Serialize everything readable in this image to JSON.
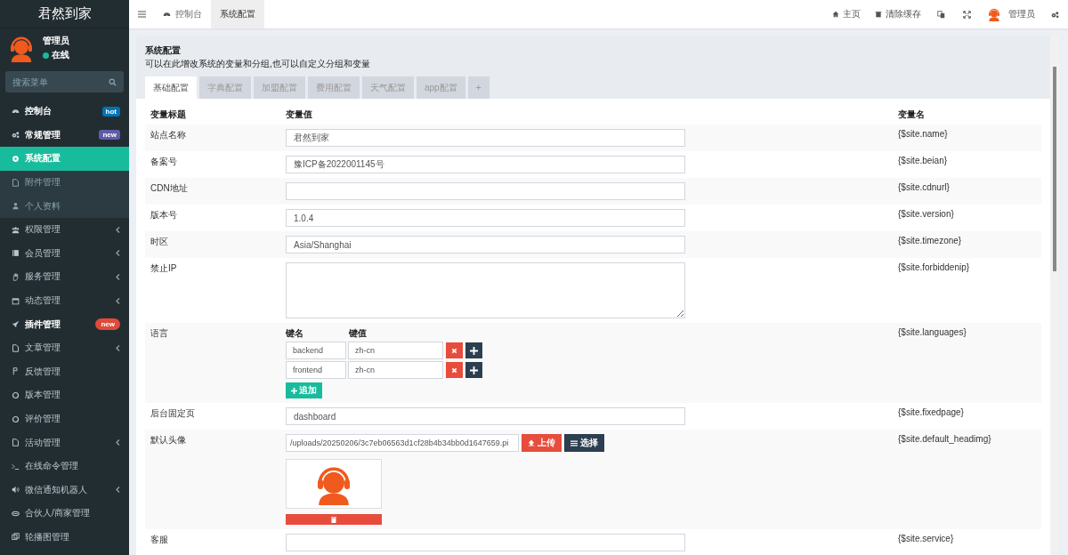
{
  "sidebar": {
    "logo": "君然到家",
    "user": {
      "name": "管理员",
      "status": "在线",
      "online": true
    },
    "search": {
      "placeholder": "搜索菜单"
    },
    "items": [
      {
        "label": "控制台",
        "badge": {
          "text": "hot",
          "color": "#0073b7"
        },
        "caret": false,
        "selected": false
      },
      {
        "label": "常规管理",
        "badge": {
          "text": "new",
          "color": "#605ca8"
        },
        "caret": false,
        "selected": false,
        "expanded": true,
        "children": [
          {
            "label": "系统配置",
            "selected": true
          },
          {
            "label": "附件管理",
            "selected": false
          },
          {
            "label": "个人资料",
            "selected": false
          }
        ]
      },
      {
        "label": "权限管理",
        "caret": true,
        "selected": false
      },
      {
        "label": "会员管理",
        "caret": true,
        "selected": false
      },
      {
        "label": "服务管理",
        "caret": true,
        "selected": false
      },
      {
        "label": "动态管理",
        "caret": true,
        "selected": false
      },
      {
        "label": "插件管理",
        "badge": {
          "text": "new",
          "color": "#dd4b39"
        },
        "caret": false,
        "selected": false
      },
      {
        "label": "文章管理",
        "caret": true,
        "selected": false
      },
      {
        "label": "反馈管理",
        "caret": false,
        "selected": false
      },
      {
        "label": "版本管理",
        "caret": false,
        "selected": false
      },
      {
        "label": "评价管理",
        "caret": false,
        "selected": false
      },
      {
        "label": "活动管理",
        "caret": true,
        "selected": false
      },
      {
        "label": "在线命令管理",
        "caret": false,
        "selected": false
      },
      {
        "label": "微信通知机器人",
        "caret": true,
        "selected": false
      },
      {
        "label": "合伙人/商家管理",
        "caret": false,
        "selected": false
      },
      {
        "label": "轮播图管理",
        "caret": false,
        "selected": false
      }
    ]
  },
  "topbar": {
    "tabs": [
      {
        "label": "控制台",
        "selected": false
      },
      {
        "label": "系统配置",
        "selected": true
      }
    ],
    "links": [
      "主页",
      "清除缓存",
      "管理员"
    ]
  },
  "panel": {
    "title": "系统配置",
    "subtitle": "可以在此增改系统的变量和分组,也可以自定义分组和变量",
    "tabs": [
      {
        "label": "基础配置",
        "selected": true
      },
      {
        "label": "字典配置",
        "selected": false
      },
      {
        "label": "加盟配置",
        "selected": false
      },
      {
        "label": "费用配置",
        "selected": false
      },
      {
        "label": "天气配置",
        "selected": false
      },
      {
        "label": "app配置",
        "selected": false
      },
      {
        "label": "+",
        "selected": false
      }
    ],
    "columns": [
      "变量标题",
      "变量值",
      "变量名"
    ],
    "rows": [
      {
        "kind": "text",
        "title": "站点名称",
        "value": "君然到家",
        "var": "{$site.name}"
      },
      {
        "kind": "text",
        "title": "备案号",
        "value": "豫ICP备2022001145号",
        "var": "{$site.beian}"
      },
      {
        "kind": "text",
        "title": "CDN地址",
        "var": "{$site.cdnurl}"
      },
      {
        "kind": "text",
        "title": "版本号",
        "value": "1.0.4",
        "var": "{$site.version}"
      },
      {
        "kind": "text",
        "title": "时区",
        "value": "Asia/Shanghai",
        "var": "{$site.timezone}"
      },
      {
        "kind": "textarea",
        "title": "禁止IP",
        "var": "{$site.forbiddenip}"
      },
      {
        "kind": "array",
        "title": "语言",
        "key_label": "键名",
        "value_label": "键值",
        "pairs": [
          {
            "key": "backend",
            "value": "zh-cn"
          },
          {
            "key": "frontend",
            "value": "zh-cn"
          }
        ],
        "add_label": "追加",
        "var": "{$site.languages}"
      },
      {
        "kind": "text",
        "title": "后台固定页",
        "value": "dashboard",
        "var": "{$site.fixedpage}"
      },
      {
        "kind": "image",
        "title": "默认头像",
        "value": "/uploads/20250206/3c7eb06563d1cf28b4b34bb0d1647659.pi",
        "upload_label": "上传",
        "choose_label": "选择",
        "var": "{$site.default_headimg}"
      },
      {
        "kind": "text",
        "title": "客服",
        "var": "{$site.service}"
      }
    ]
  }
}
